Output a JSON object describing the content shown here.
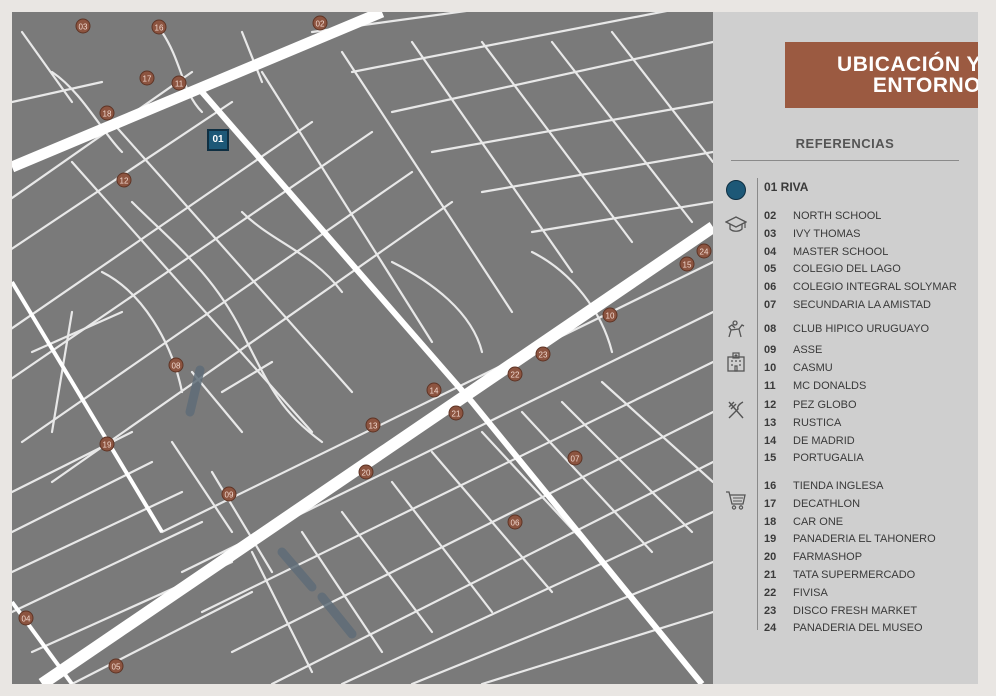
{
  "header": {
    "title_line1": "UBICACIÓN Y",
    "title_line2": "ENTORNO",
    "references_label": "REFERENCIAS"
  },
  "main_location": {
    "id": "01",
    "label": "01 RIVA"
  },
  "colors": {
    "marker": "#8c5440",
    "main_marker": "#1d5877",
    "title_bg": "#9b5a41",
    "map_bg": "#7a7a7a",
    "road": "#f2f2f2",
    "panel_bg": "#cfcfcf"
  },
  "categories": [
    {
      "icon": "graduation-cap-icon",
      "items": [
        {
          "num": "02",
          "name": "NORTH SCHOOL"
        },
        {
          "num": "03",
          "name": "IVY THOMAS"
        },
        {
          "num": "04",
          "name": "MASTER SCHOOL"
        },
        {
          "num": "05",
          "name": "COLEGIO DEL LAGO"
        },
        {
          "num": "06",
          "name": "COLEGIO INTEGRAL SOLYMAR"
        },
        {
          "num": "07",
          "name": "SECUNDARIA LA AMISTAD"
        }
      ]
    },
    {
      "icon": "horse-rider-icon",
      "items": [
        {
          "num": "08",
          "name": "CLUB HIPICO URUGUAYO"
        }
      ]
    },
    {
      "icon": "hospital-building-icon",
      "items": [
        {
          "num": "09",
          "name": "ASSE"
        },
        {
          "num": "10",
          "name": "CASMU"
        },
        {
          "num": "11",
          "name": "MC DONALDS"
        }
      ]
    },
    {
      "icon": "fork-knife-icon",
      "items": [
        {
          "num": "12",
          "name": "PEZ GLOBO"
        },
        {
          "num": "13",
          "name": "RUSTICA"
        },
        {
          "num": "14",
          "name": "DE MADRID"
        },
        {
          "num": "15",
          "name": "PORTUGALIA"
        }
      ]
    },
    {
      "icon": "shopping-cart-icon",
      "items": [
        {
          "num": "16",
          "name": "TIENDA INGLESA"
        },
        {
          "num": "17",
          "name": "DECATHLON"
        },
        {
          "num": "18",
          "name": "CAR ONE"
        },
        {
          "num": "19",
          "name": "PANADERIA EL TAHONERO"
        },
        {
          "num": "20",
          "name": "FARMASHOP"
        },
        {
          "num": "21",
          "name": "TATA SUPERMERCADO"
        },
        {
          "num": "22",
          "name": "FIVISA"
        },
        {
          "num": "23",
          "name": "DISCO FRESH MARKET"
        },
        {
          "num": "24",
          "name": "PANADERIA DEL MUSEO"
        }
      ]
    }
  ],
  "map_markers": [
    "02",
    "03",
    "16",
    "17",
    "11",
    "18",
    "12",
    "15",
    "24",
    "10",
    "08",
    "23",
    "22",
    "14",
    "21",
    "13",
    "19",
    "20",
    "07",
    "09",
    "06",
    "04",
    "05"
  ]
}
